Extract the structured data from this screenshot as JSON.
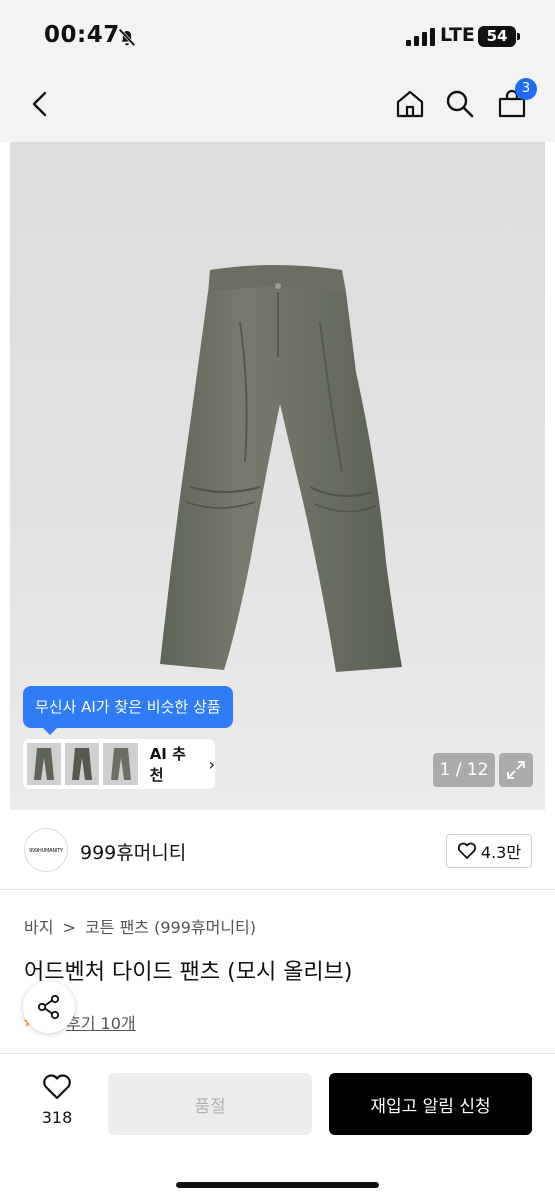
{
  "status": {
    "time": "00:47",
    "network": "LTE",
    "battery": "54"
  },
  "nav": {
    "cart_count": "3"
  },
  "gallery": {
    "ai_tooltip": "무신사 AI가 찾은 비슷한 상품",
    "ai_label": "AI 추천",
    "counter": "1 / 12"
  },
  "brand": {
    "logo_text": "999HUMANITY",
    "name": "999휴머니티",
    "likes": "4.3만"
  },
  "breadcrumb": {
    "category": "바지",
    "separator": ">",
    "subcategory": "코튼 팬츠 (999휴머니티)"
  },
  "product": {
    "title": "어드벤처 다이드 팬츠 (모시 올리브)",
    "reviews": "후기 10개"
  },
  "actions": {
    "wish_count": "318",
    "soldout": "품절",
    "restock": "재입고 알림 신청"
  },
  "colors": {
    "accent": "#2f7cf6",
    "badge": "#1f6cf2",
    "pants": "#6f7466"
  }
}
